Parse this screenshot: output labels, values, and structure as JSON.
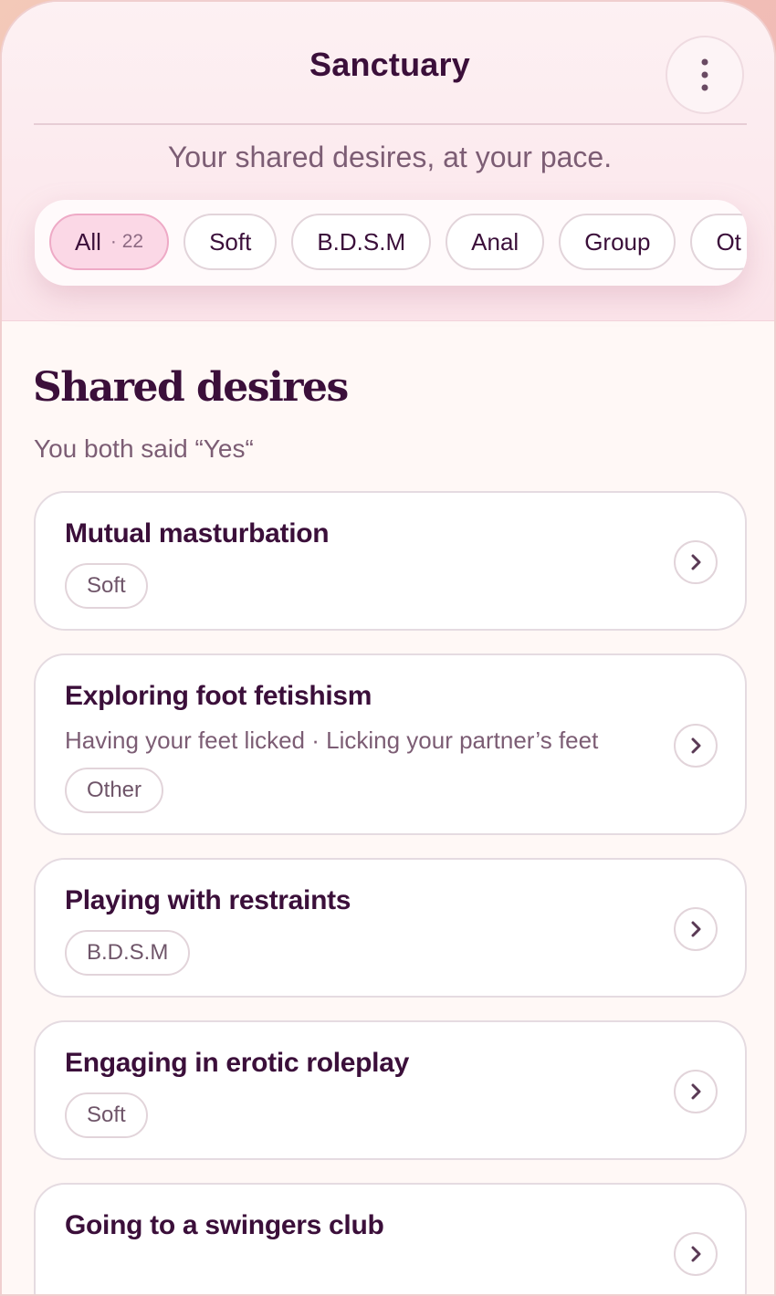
{
  "header": {
    "title": "Sanctuary",
    "menu_icon": "more-vertical-icon",
    "tagline": "Your shared desires, at your pace."
  },
  "filters": [
    {
      "label": "All",
      "count": "· 22",
      "active": true
    },
    {
      "label": "Soft",
      "active": false
    },
    {
      "label": "B.D.S.M",
      "active": false
    },
    {
      "label": "Anal",
      "active": false
    },
    {
      "label": "Group",
      "active": false
    },
    {
      "label": "Ot",
      "active": false
    }
  ],
  "section": {
    "title": "Shared desires",
    "subtitle": "You both said “Yes“"
  },
  "items": [
    {
      "title": "Mutual masturbation",
      "description": "",
      "tag": "Soft"
    },
    {
      "title": "Exploring foot fetishism",
      "description": "Having your feet licked · Licking your partner’s feet",
      "tag": "Other"
    },
    {
      "title": "Playing with restraints",
      "description": "",
      "tag": "B.D.S.M"
    },
    {
      "title": "Engaging in erotic roleplay",
      "description": "",
      "tag": "Soft"
    },
    {
      "title": "Going to a swingers club",
      "description": "",
      "tag": ""
    }
  ],
  "colors": {
    "primary_text": "#3b0f3a",
    "secondary_text": "#7c5d74",
    "active_chip": "#fbd8e6",
    "header_bg": "#fbe4ea"
  }
}
